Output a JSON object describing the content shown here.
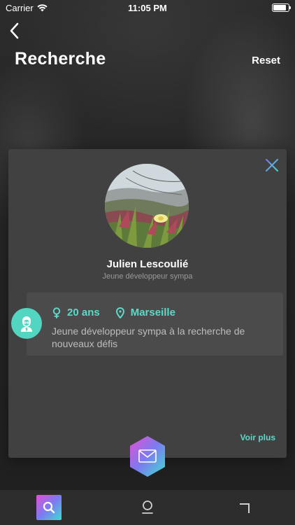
{
  "status_bar": {
    "carrier": "Carrier",
    "time": "11:05 PM",
    "battery_level": 0.85
  },
  "header": {
    "back_icon": "chevron-left-icon",
    "title": "Recherche",
    "reset_label": "Reset"
  },
  "card": {
    "close_icon": "close-icon",
    "photo": "profile-photo-plant",
    "name": "Julien Lescoulié",
    "subtitle": "Jeune développeur sympa",
    "age": "20 ans",
    "city": "Marseille",
    "description": "Jeune développeur sympa à la recherche de nouveaux défis",
    "see_more_label": "Voir plus"
  },
  "colors": {
    "accent": "#5ed9c9",
    "gradient_pink": "#e24fd4",
    "gradient_violet": "#7b7cf0",
    "gradient_teal": "#3fdad0"
  },
  "tab_bar": {
    "items": [
      {
        "icon": "search-icon",
        "active": true
      },
      {
        "icon": "profile-icon",
        "active": false
      },
      {
        "icon": "crop-icon",
        "active": false
      }
    ]
  }
}
